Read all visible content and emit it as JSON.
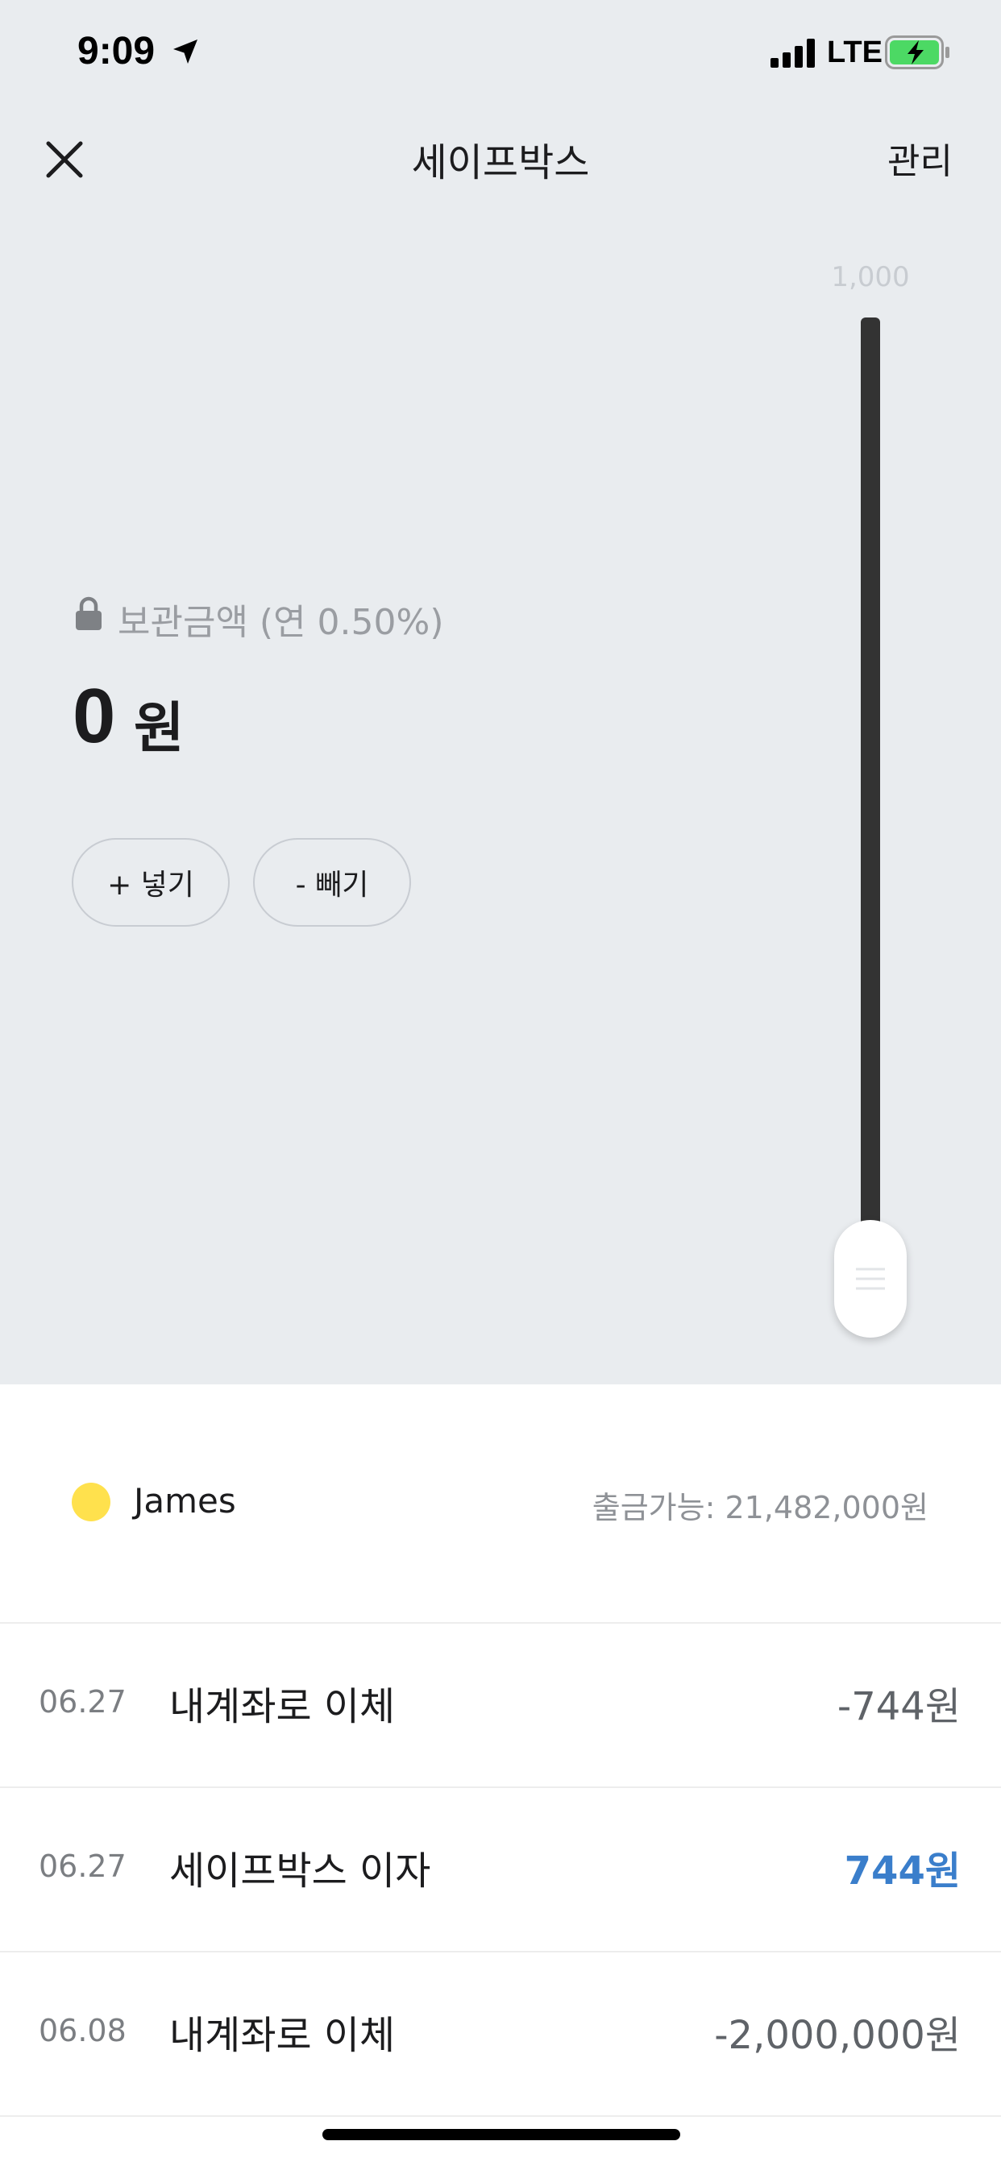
{
  "status_bar": {
    "time": "9:09",
    "network": "LTE",
    "icons": [
      "location-arrow-icon",
      "signal-icon",
      "battery-charging-icon"
    ],
    "battery_color": "#4cd964"
  },
  "nav": {
    "title": "세이프박스",
    "manage_label": "관리",
    "close_icon": "close-icon"
  },
  "slider": {
    "max_label": "1,000",
    "value_fraction": 0
  },
  "savings": {
    "label": "보관금액 (연 0.50%)",
    "amount": "0",
    "unit": "원",
    "deposit_label": "+ 넣기",
    "withdraw_label": "- 빼기"
  },
  "account": {
    "name": "James",
    "available": "출금가능: 21,482,000원",
    "dot_color": "#ffe14d"
  },
  "transactions": [
    {
      "date": "06.27",
      "title": "내계좌로 이체",
      "amount": "-744원"
    },
    {
      "date": "06.27",
      "title": "세이프박스 이자",
      "amount": "744원"
    },
    {
      "date": "06.08",
      "title": "내계좌로 이체",
      "amount": "-2,000,000원"
    }
  ],
  "colors": {
    "top_background": "#e9ecef",
    "accent_positive": "#3a7ecb"
  }
}
